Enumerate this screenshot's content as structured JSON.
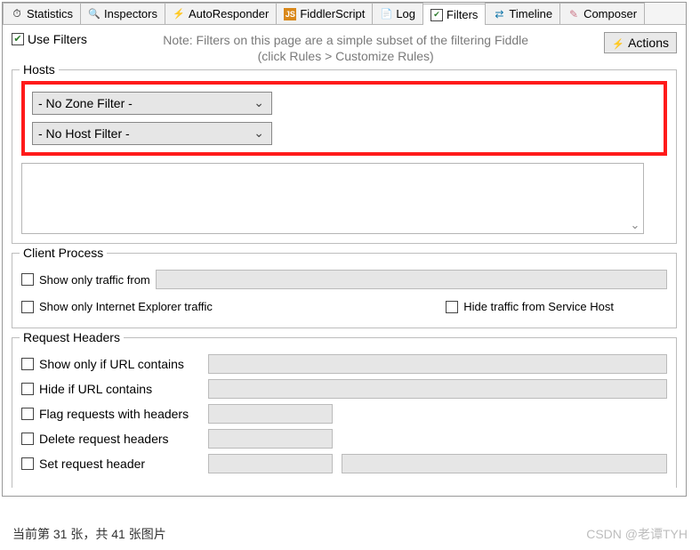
{
  "tabs": {
    "statistics": "Statistics",
    "inspectors": "Inspectors",
    "autoresponder": "AutoResponder",
    "fiddlerscript": "FiddlerScript",
    "log": "Log",
    "filters": "Filters",
    "timeline": "Timeline",
    "composer": "Composer"
  },
  "top": {
    "use_filters": "Use Filters",
    "note_line1": "Note: Filters on this page are a simple subset of the filtering Fiddle",
    "note_line2": "(click Rules > Customize Rules)",
    "actions": "Actions"
  },
  "hosts": {
    "legend": "Hosts",
    "zone_filter": "- No Zone Filter -",
    "host_filter": "- No Host Filter -"
  },
  "client_process": {
    "legend": "Client Process",
    "show_only_from": "Show only traffic from",
    "show_only_ie": "Show only Internet Explorer traffic",
    "hide_service_host": "Hide traffic from Service Host"
  },
  "request_headers": {
    "legend": "Request Headers",
    "show_if_url": "Show only if URL contains",
    "hide_if_url": "Hide if URL contains",
    "flag_with_headers": "Flag requests with headers",
    "delete_headers": "Delete request headers",
    "set_header": "Set request header"
  },
  "footer": "当前第 31 张，共 41 张图片",
  "watermark": "CSDN @老谭TYH"
}
